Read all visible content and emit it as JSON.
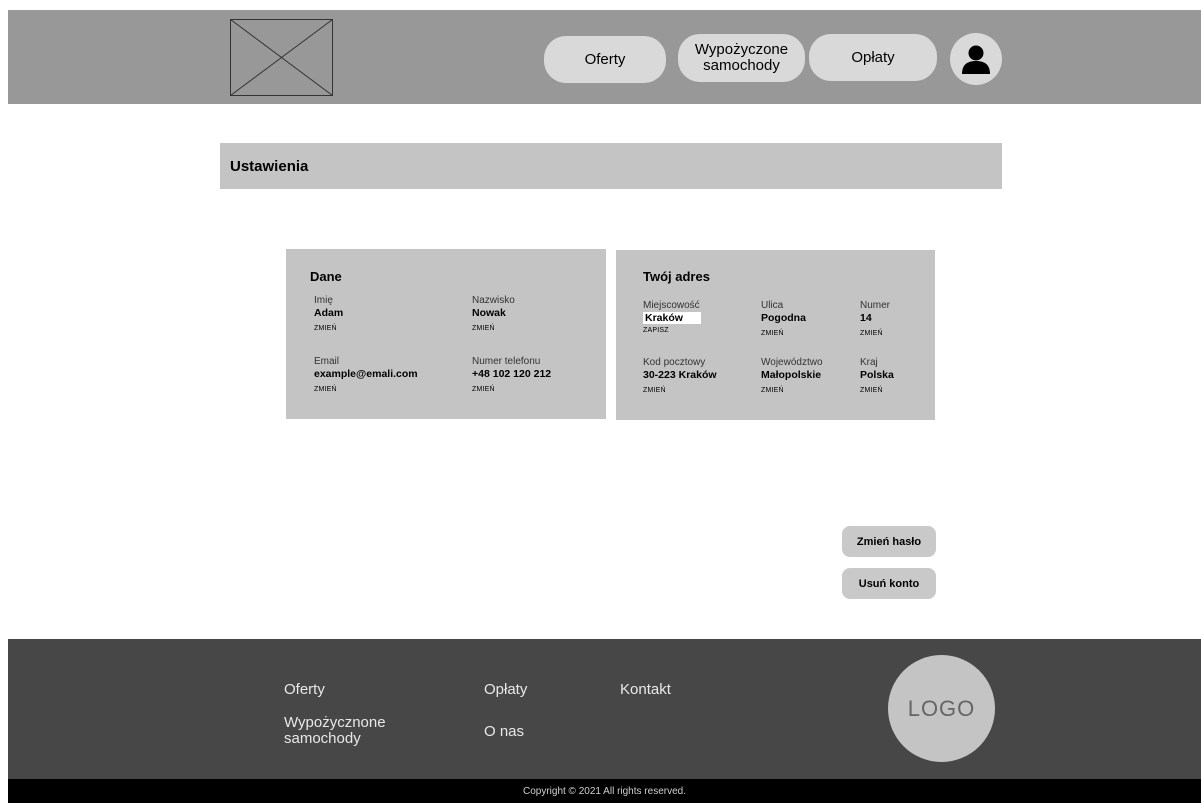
{
  "header": {
    "nav": {
      "offers": "Oferty",
      "rented": "Wypożyczone\nsamochody",
      "payments": "Opłaty"
    }
  },
  "page_title": "Ustawienia",
  "personal": {
    "title": "Dane",
    "first_name": {
      "label": "Imię",
      "value": "Adam",
      "action": "ZMIEŃ"
    },
    "last_name": {
      "label": "Nazwisko",
      "value": "Nowak",
      "action": "ZMIEŃ"
    },
    "email": {
      "label": "Email",
      "value": "example@emali.com",
      "action": "ZMIEŃ"
    },
    "phone": {
      "label": "Numer telefonu",
      "value": "+48 102 120 212",
      "action": "ZMIEŃ"
    }
  },
  "address": {
    "title": "Twój adres",
    "city": {
      "label": "Miejscowość",
      "value": "Kraków",
      "action": "ZAPISZ"
    },
    "street": {
      "label": "Ulica",
      "value": "Pogodna",
      "action": "ZMIEŃ"
    },
    "number": {
      "label": "Numer",
      "value": "14",
      "action": "ZMIEŃ"
    },
    "postal": {
      "label": "Kod pocztowy",
      "value": "30-223 Kraków",
      "action": "ZMIEŃ"
    },
    "region": {
      "label": "Województwo",
      "value": "Małopolskie",
      "action": "ZMIEŃ"
    },
    "country": {
      "label": "Kraj",
      "value": "Polska",
      "action": "ZMIEŃ"
    }
  },
  "actions": {
    "change_password": "Zmień hasło",
    "delete_account": "Usuń konto"
  },
  "footer": {
    "links": {
      "offers": "Oferty",
      "rented": "Wypożycznone\nsamochody",
      "payments": "Opłaty",
      "about": "O nas",
      "contact": "Kontakt"
    },
    "logo": "LOGO",
    "copyright": "Copyright © 2021 All rights reserved."
  }
}
